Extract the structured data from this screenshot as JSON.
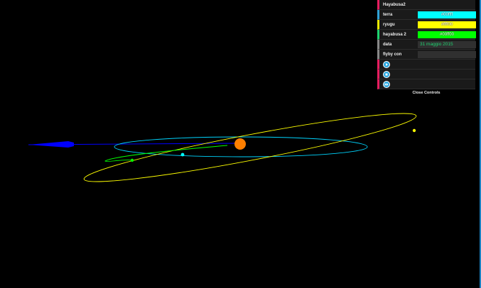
{
  "panel": {
    "title": "Hayabusa2",
    "rows": [
      {
        "label": "terra",
        "value": "#00ffff",
        "color": "#00ffff"
      },
      {
        "label": "ryugu",
        "value": "#ffff00",
        "color": "#ffff00"
      },
      {
        "label": "hayabusa 2",
        "value": "#00ff00",
        "color": "#00ff00"
      }
    ],
    "data_label": "data",
    "data_value": "31 maggio 2015",
    "flyby_label": "flyby con",
    "flyby_value": "",
    "buttons": [
      "play-icon",
      "stop-icon",
      "fast-forward-icon"
    ],
    "close_label": "Close Controls"
  },
  "scene": {
    "sun_color": "#ff7f00",
    "earth_orbit_color": "#00d5ff",
    "ryugu_orbit_color": "#ffff00",
    "hayabusa_orbit_color": "#00ff00",
    "arrow_color": "#0000ff",
    "earth_color": "#00ffff",
    "ryugu_color": "#ffff00",
    "hayabusa_color": "#00ff00"
  }
}
